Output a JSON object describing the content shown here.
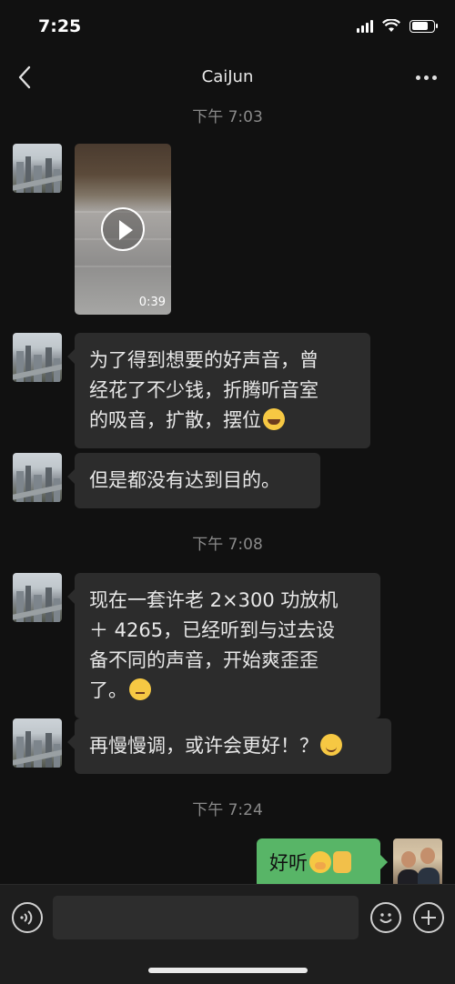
{
  "status_bar": {
    "time": "7:25"
  },
  "header": {
    "title": "CaiJun"
  },
  "messages": [
    {
      "type": "time",
      "text": "下午 7:03"
    },
    {
      "type": "video",
      "duration": "0:39"
    },
    {
      "type": "text",
      "lines": [
        "为了得到想要的好声音，曾",
        "经花了不少钱，折腾听音室",
        "的吸音，扩散，摆位"
      ],
      "emoji": "laughing-tears"
    },
    {
      "type": "text",
      "lines": [
        "但是都没有达到目的。"
      ]
    },
    {
      "type": "time",
      "text": "下午 7:08"
    },
    {
      "type": "text",
      "lines": [
        "现在一套许老 2×300 功放机",
        "＋ 4265，已经听到与过去设",
        "备不同的声音，开始爽歪歪",
        "了。"
      ],
      "emoji": "thinking-face"
    },
    {
      "type": "text",
      "lines": [
        "再慢慢调，或许会更好！？"
      ],
      "emoji": "smiling-face"
    },
    {
      "type": "time",
      "text": "下午 7:24"
    },
    {
      "type": "text",
      "sender": "me",
      "lines": [
        "好听"
      ],
      "emoji": "shushing-face thumbs-up"
    }
  ],
  "colors": {
    "background": "#111111",
    "bubble_in": "#2c2c2c",
    "bubble_out": "#58b567",
    "timestamp": "#8a8a8a"
  }
}
